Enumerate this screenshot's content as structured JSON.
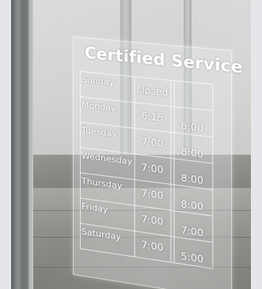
{
  "sign": {
    "title": "Certified Service",
    "hours": [
      {
        "day": "Sunday",
        "open": "closed",
        "close": ""
      },
      {
        "day": "Monday",
        "open": "6:15",
        "close": "8:00"
      },
      {
        "day": "Tuesday",
        "open": "7:00",
        "close": "8:00"
      },
      {
        "day": "Wednesday",
        "open": "7:00",
        "close": "8:00"
      },
      {
        "day": "Thursday",
        "open": "7:00",
        "close": "8:00"
      },
      {
        "day": "Friday",
        "open": "7:00",
        "close": "7:00"
      },
      {
        "day": "Saturday",
        "open": "7:00",
        "close": "5:00"
      }
    ]
  }
}
